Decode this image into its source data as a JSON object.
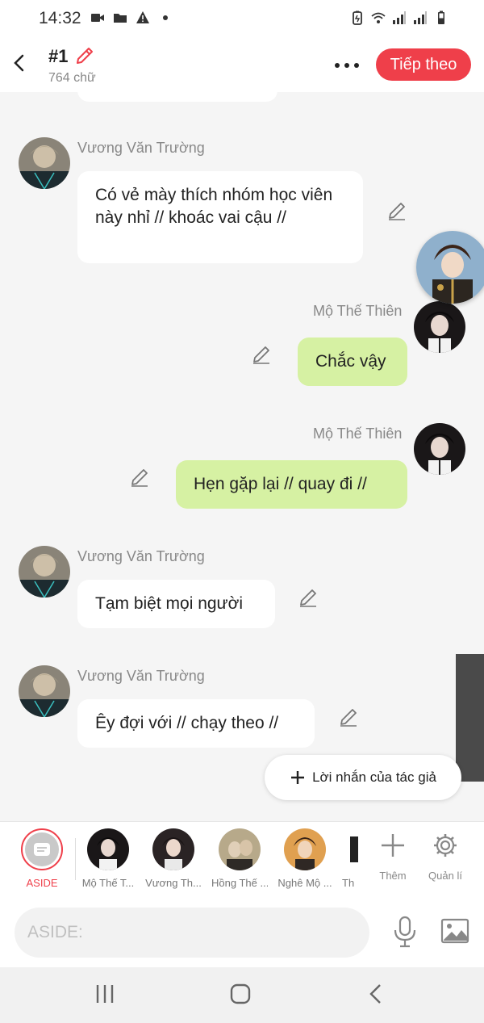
{
  "status_bar": {
    "time": "14:32"
  },
  "header": {
    "title": "#1",
    "word_count": "764 chữ",
    "next_button": "Tiếp theo"
  },
  "messages": [
    {
      "sender": "Vương Văn Trường",
      "text": "Có vẻ mày thích nhóm học viên này nhỉ // khoác vai cậu //",
      "side": "left"
    },
    {
      "sender": "Mộ Thế Thiên",
      "text": "Chắc vậy",
      "side": "right"
    },
    {
      "sender": "Mộ Thế Thiên",
      "text": "Hẹn gặp lại // quay đi //",
      "side": "right"
    },
    {
      "sender": "Vương Văn Trường",
      "text": "Tạm biệt mọi người",
      "side": "left"
    },
    {
      "sender": "Vương Văn Trường",
      "text": "Êy đợi với // chạy theo //",
      "side": "left"
    }
  ],
  "author_note_button": "Lời nhắn của tác giả",
  "characters": {
    "aside": "ASIDE",
    "items": [
      "Mộ Thế T...",
      "Vương Th...",
      "Hồng Thế ...",
      "Nghê Mộ ...",
      "Th"
    ],
    "add_label": "Thêm",
    "manage_label": "Quản lí"
  },
  "composer": {
    "placeholder": "ASIDE:"
  },
  "colors": {
    "accent": "#ef3f4a",
    "my_bubble": "#d6f1a3",
    "bubble": "#ffffff",
    "background": "#f5f5f5"
  }
}
